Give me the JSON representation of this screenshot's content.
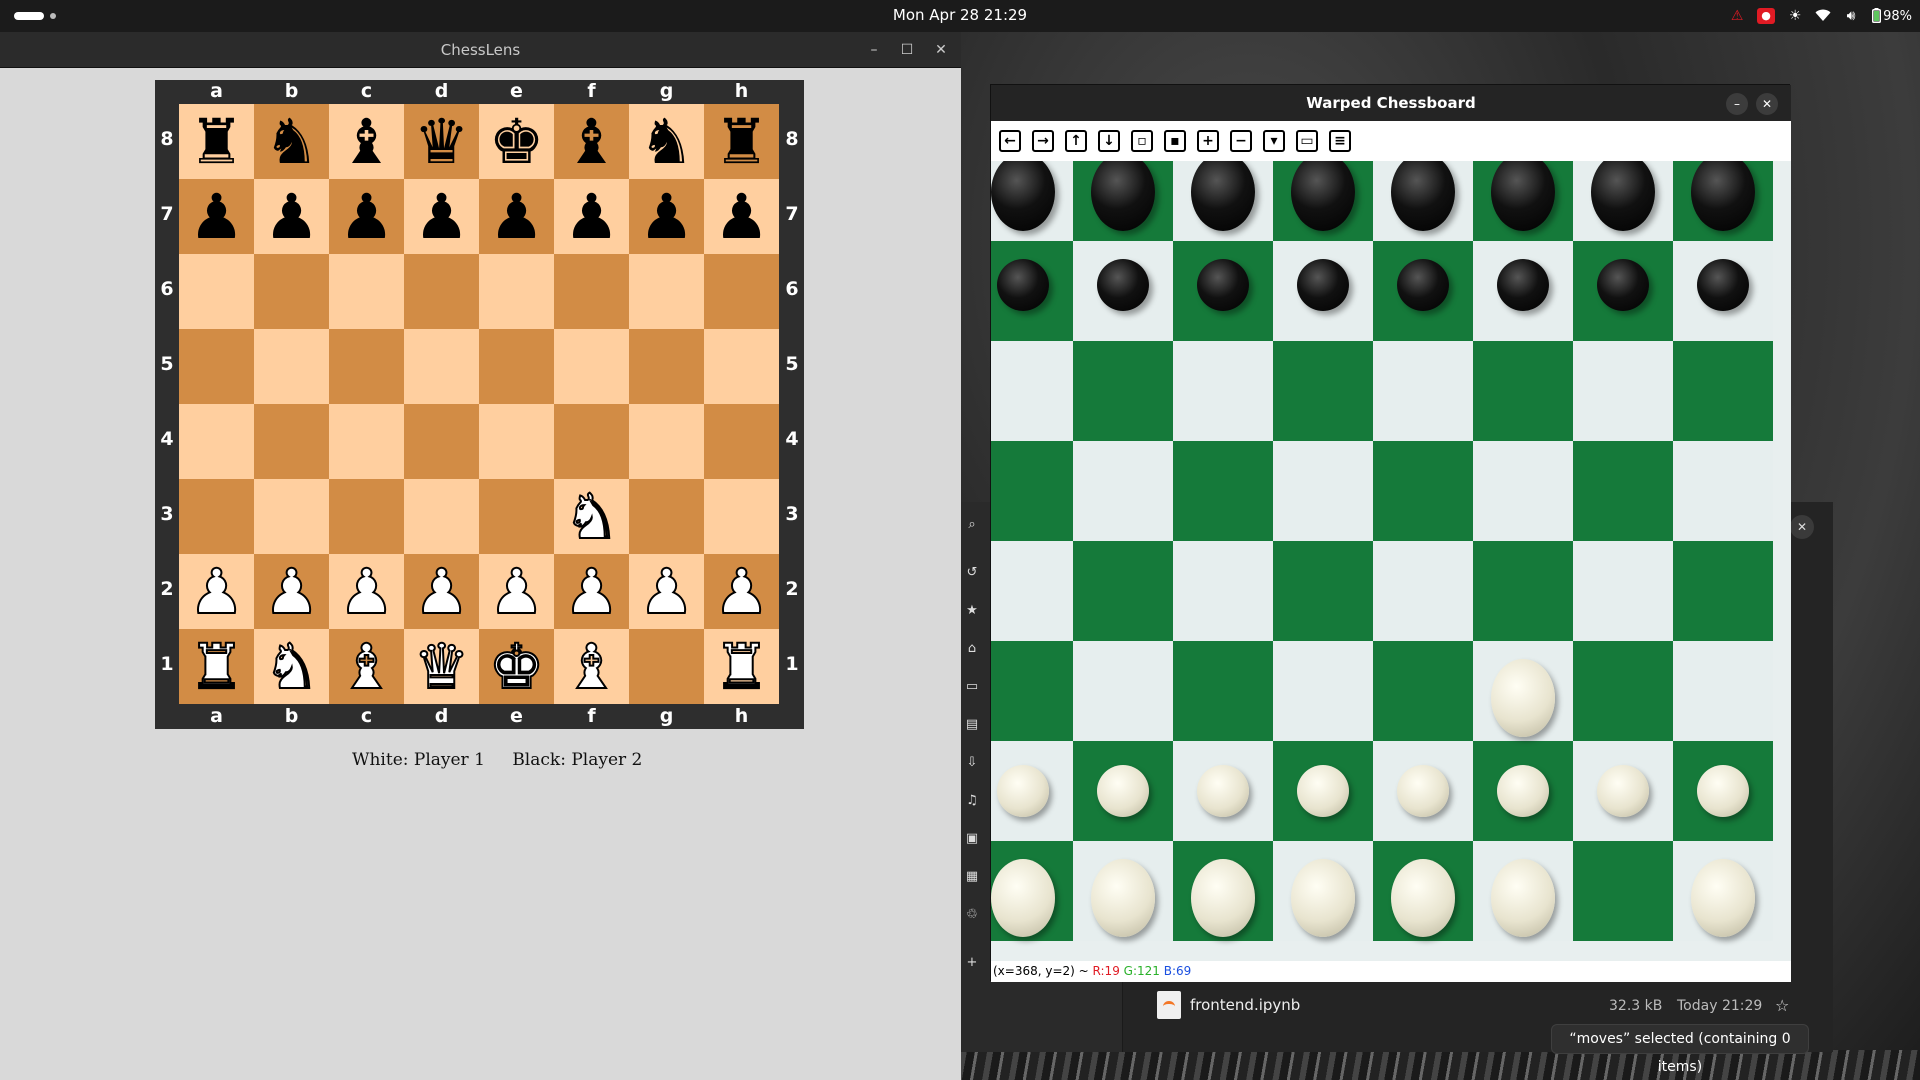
{
  "topbar": {
    "clock": "Mon Apr 28  21:29",
    "battery": "98%",
    "icons": [
      "warning-icon",
      "screen-record-icon",
      "brightness-icon",
      "wifi-icon",
      "volume-icon",
      "battery-icon"
    ]
  },
  "chesslens": {
    "title": "ChessLens",
    "files": [
      "a",
      "b",
      "c",
      "d",
      "e",
      "f",
      "g",
      "h"
    ],
    "ranks": [
      "8",
      "7",
      "6",
      "5",
      "4",
      "3",
      "2",
      "1"
    ],
    "colors": {
      "light_square": "#ffcf9f",
      "dark_square": "#d28c45",
      "frame": "#2e2e2e"
    },
    "position": {
      "a8": "r",
      "b8": "n",
      "c8": "b",
      "d8": "q",
      "e8": "k",
      "f8": "b",
      "g8": "n",
      "h8": "r",
      "a7": "p",
      "b7": "p",
      "c7": "p",
      "d7": "p",
      "e7": "p",
      "f7": "p",
      "g7": "p",
      "h7": "p",
      "f3": "N",
      "a2": "P",
      "b2": "P",
      "c2": "P",
      "d2": "P",
      "e2": "P",
      "f2": "P",
      "g2": "P",
      "h2": "P",
      "a1": "R",
      "b1": "N",
      "c1": "B",
      "d1": "Q",
      "e1": "K",
      "f1": "B",
      "h1": "R"
    },
    "white_player": "White: Player 1",
    "black_player": "Black: Player 2"
  },
  "warped": {
    "title": "Warped Chessboard",
    "toolbar": [
      "pan-left-icon",
      "pan-right-icon",
      "pan-up-icon",
      "pan-down-icon",
      "zoom-fit-icon",
      "zoom-original-icon",
      "zoom-in-icon",
      "zoom-out-icon",
      "save-image-icon",
      "copy-clipboard-icon",
      "properties-icon"
    ],
    "colors": {
      "white_square": "#e6eeee",
      "green_square": "#157a3a"
    },
    "status_coords": "(x=368, y=2) ~",
    "status_r": "R:19",
    "status_g": "G:121",
    "status_b": "B:69"
  },
  "filemanager": {
    "sidebar_icons": [
      "search-icon",
      "recent-icon",
      "starred-icon",
      "home-icon",
      "desktop-icon",
      "documents-icon",
      "downloads-icon",
      "music-icon",
      "pictures-icon",
      "videos-icon",
      "trash-icon",
      "add-location-icon"
    ],
    "file": {
      "name": "frontend.ipynb",
      "size": "32.3 kB",
      "modified": "Today 21:29"
    },
    "status": "“moves” selected  (containing 0 items)"
  }
}
